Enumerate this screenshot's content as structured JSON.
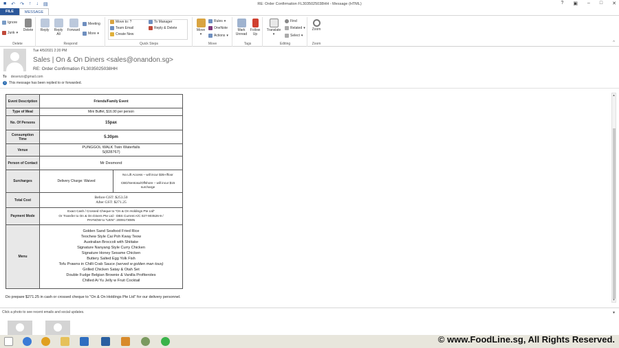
{
  "window": {
    "title": "RE: Order Confirmation FL3035025038HH - Message (HTML)"
  },
  "tabs": {
    "file": "FILE",
    "message": "MESSAGE"
  },
  "ribbon": {
    "delete": {
      "ignore": "Ignore",
      "junk": "Junk",
      "delete": "Delete",
      "label": "Delete"
    },
    "respond": {
      "reply": "Reply",
      "reply_all": "Reply All",
      "forward": "Forward",
      "meeting": "Meeting",
      "more": "More",
      "label": "Respond"
    },
    "quicksteps": {
      "move_to": "Move to: ?",
      "team_email": "Team Email",
      "create_new": "Create New",
      "to_manager": "To Manager",
      "reply_delete": "Reply & Delete",
      "label": "Quick Steps"
    },
    "move": {
      "move": "Move",
      "rules": "Rules",
      "onenote": "OneNote",
      "actions": "Actions",
      "label": "Move"
    },
    "tags": {
      "mark_unread": "Mark Unread",
      "follow_up": "Follow Up",
      "label": "Tags"
    },
    "editing": {
      "translate": "Translate",
      "find": "Find",
      "related": "Related",
      "select": "Select",
      "label": "Editing"
    },
    "zoom": {
      "zoom": "Zoom",
      "label": "Zoom"
    }
  },
  "message": {
    "date": "Tue 4/5/2021 2:20 PM",
    "sender": "Sales | On & On Diners <sales@onandon.sg>",
    "subject": "RE: Order Confirmation FL3035025038HH",
    "to_label": "To",
    "to_value": "desenzo@gmail.com",
    "info": "This message has been replied to or forwarded."
  },
  "order": {
    "event_label": "Event Description",
    "event_value": "Friends/Family Event",
    "meal_label": "Type of Meal",
    "meal_value": "Mini Buffet, $16.90 per person",
    "persons_label": "No. Of Persons",
    "persons_value": "15pax",
    "time_label": "Consumption Time",
    "time_value": "5.30pm",
    "venue_label": "Venue",
    "venue_line1": "PUNGGOL WALK Twin Waterfalls",
    "venue_line2": "S(828767)",
    "contact_label": "Person of Contact",
    "contact_value": "Mr Desmond",
    "surcharge_label": "Surcharges",
    "surcharge_delivery": "Delivery Charge: Waived",
    "surcharge_lift": "No Lift Access – will incur $35+/floor",
    "surcharge_cbd": "CBD/Sentosa/Offshore – will incur $15 surcharge",
    "total_label": "Total Cost",
    "total_before": "Before GST: $253.50",
    "total_after": "After GST: $271.25",
    "payment_label": "Payment Mode",
    "payment_line1": "Exact Cash / Crossed Cheque to \"On & On Holdings Pte Ltd\"",
    "payment_line2": "Or Transfer to On & On Diners Pte Ltd - DBS Current A/C 027-903526-9 /",
    "payment_line3": "PAYNOW to \"UEN\": 200917308N",
    "menu_label": "Menu",
    "menu_items": [
      "Golden Sand Seafood Fried Rice",
      "Teochew Style Cai Poh Kway Teow",
      "Australian Broccoli with Shiitake",
      "Signature Nanyang Style Curry Chicken",
      "Signature Honey Sesame Chicken",
      "Buttery Salted Egg Yolk Fish",
      "Grilled Chicken Satay & Otah Set",
      "Double Fudge Belgian Brownie & Vanilla Profiteroles",
      "Chilled Ai Yu Jelly w Fruit Cocktail"
    ],
    "tofu_main": "Tofu Prawns in Chilli Crab Sauce",
    "tofu_italic": "(served w golden man tous)"
  },
  "footer_note": "Do prepare $271.25  in cash or crossed cheque to \"On & On Holdings Pte Ltd\" for our delivery personnel.",
  "people_pane": {
    "text": "Click a photo to see recent emails and social updates."
  },
  "watermark": "© www.FoodLine.sg, All Rights Reserved."
}
